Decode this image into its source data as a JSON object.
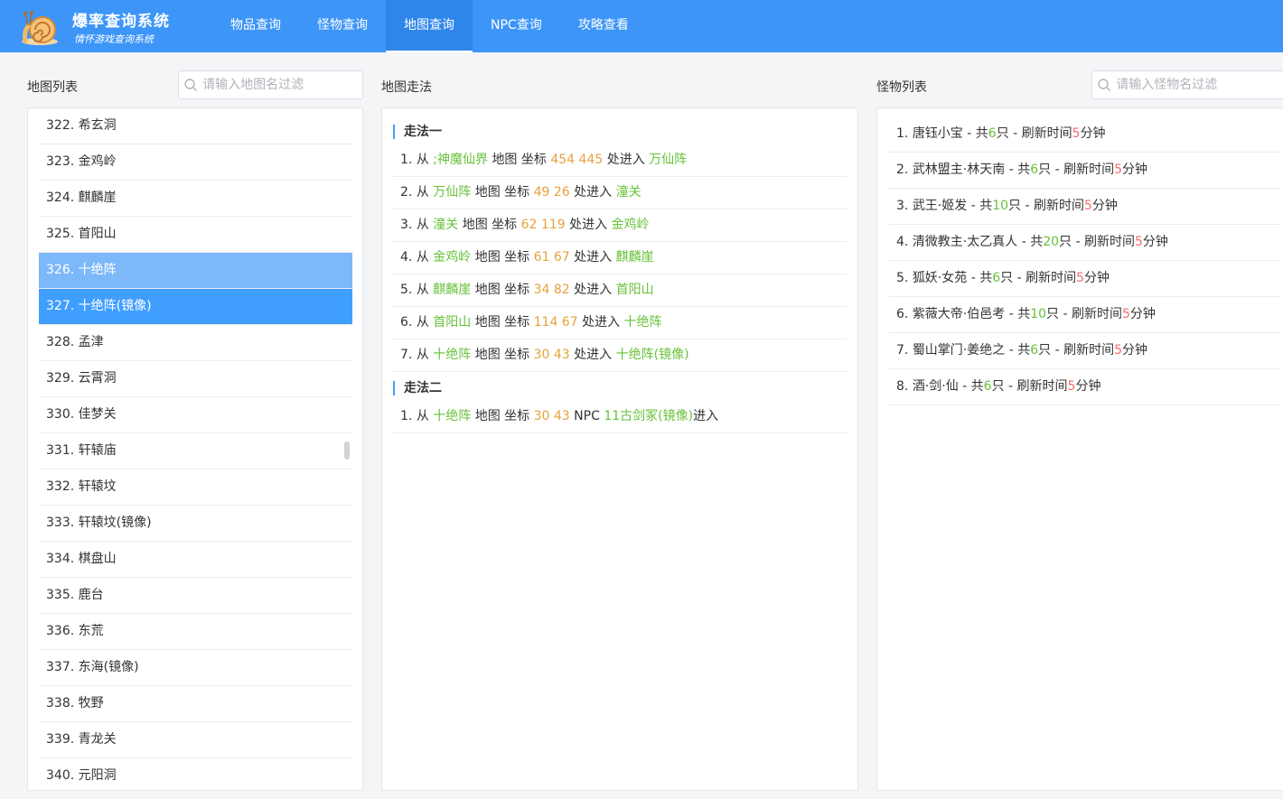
{
  "brand": {
    "title": "爆率查询系统",
    "subtitle": "情怀游戏查询系统"
  },
  "nav": [
    "物品查询",
    "怪物查询",
    "地图查询",
    "NPC查询",
    "攻略查看"
  ],
  "map_section": {
    "title": "地图列表",
    "search_placeholder": "请输入地图名过滤"
  },
  "route_section": {
    "title": "地图走法"
  },
  "monster_section": {
    "title": "怪物列表",
    "search_placeholder": "请输入怪物名过滤"
  },
  "maps": [
    "322.  希玄洞",
    "323.  金鸡岭",
    "324.  麒麟崖",
    "325.  首阳山",
    "326.  十绝阵",
    "327.  十绝阵(镜像)",
    "328.  孟津",
    "329.  云霄洞",
    "330.  佳梦关",
    "331.  轩辕庙",
    "332.  轩辕坟",
    "333.  轩辕坟(镜像)",
    "334.  棋盘山",
    "335.  鹿台",
    "336.  东荒",
    "337.  东海(镜像)",
    "338.  牧野",
    "339.  青龙关",
    "340.  元阳洞"
  ],
  "routes": [
    {
      "title": "走法一",
      "steps": [
        {
          "no": "1.",
          "from": "从",
          "src": ";神魔仙界",
          "mid": "地图 坐标",
          "coord": "454 445",
          "act": "处进入",
          "dst": "万仙阵"
        },
        {
          "no": "2.",
          "from": "从",
          "src": "万仙阵",
          "mid": "地图 坐标",
          "coord": "49 26",
          "act": "处进入",
          "dst": "潼关"
        },
        {
          "no": "3.",
          "from": "从",
          "src": "潼关",
          "mid": "地图 坐标",
          "coord": "62 119",
          "act": "处进入",
          "dst": "金鸡岭"
        },
        {
          "no": "4.",
          "from": "从",
          "src": "金鸡岭",
          "mid": "地图 坐标",
          "coord": "61 67",
          "act": "处进入",
          "dst": "麒麟崖"
        },
        {
          "no": "5.",
          "from": "从",
          "src": "麒麟崖",
          "mid": "地图 坐标",
          "coord": "34 82",
          "act": "处进入",
          "dst": "首阳山"
        },
        {
          "no": "6.",
          "from": "从",
          "src": "首阳山",
          "mid": "地图 坐标",
          "coord": "114 67",
          "act": "处进入",
          "dst": "十绝阵"
        },
        {
          "no": "7.",
          "from": "从",
          "src": "十绝阵",
          "mid": "地图 坐标",
          "coord": "30 43",
          "act": "处进入",
          "dst": "十绝阵(镜像)"
        }
      ]
    },
    {
      "title": "走法二",
      "steps": [
        {
          "no": "1.",
          "from": "从",
          "src": "十绝阵",
          "mid": "地图 坐标",
          "coord": "30 43",
          "act": "NPC",
          "dst": "11古剑冢(镜像)",
          "tail": "进入"
        }
      ]
    }
  ],
  "monsters": [
    {
      "no": "1.",
      "name": "唐钰小宝",
      "a": " - 共",
      "count": "6",
      "b": "只 - 刷新时间",
      "time": "5",
      "c": "分钟"
    },
    {
      "no": "2.",
      "name": "武林盟主·林天南",
      "a": " - 共",
      "count": "6",
      "b": "只 - 刷新时间",
      "time": "5",
      "c": "分钟"
    },
    {
      "no": "3.",
      "name": "武王·姬发",
      "a": " - 共",
      "count": "10",
      "b": "只 - 刷新时间",
      "time": "5",
      "c": "分钟"
    },
    {
      "no": "4.",
      "name": "清微教主·太乙真人",
      "a": " - 共",
      "count": "20",
      "b": "只 - 刷新时间",
      "time": "5",
      "c": "分钟"
    },
    {
      "no": "5.",
      "name": "狐妖·女苑",
      "a": " - 共",
      "count": "6",
      "b": "只 - 刷新时间",
      "time": "5",
      "c": "分钟"
    },
    {
      "no": "6.",
      "name": "紫薇大帝·伯邑考",
      "a": " - 共",
      "count": "10",
      "b": "只 - 刷新时间",
      "time": "5",
      "c": "分钟"
    },
    {
      "no": "7.",
      "name": "蜀山掌门·姜绝之",
      "a": " - 共",
      "count": "6",
      "b": "只 - 刷新时间",
      "time": "5",
      "c": "分钟"
    },
    {
      "no": "8.",
      "name": "酒·剑·仙",
      "a": " - 共",
      "count": "6",
      "b": "只 - 刷新时间",
      "time": "5",
      "c": "分钟"
    }
  ],
  "colors": {
    "header": "#3d95f7",
    "accent": "#409eff",
    "green": "#67c23a",
    "orange": "#e6a23c",
    "red": "#f56c6c"
  }
}
